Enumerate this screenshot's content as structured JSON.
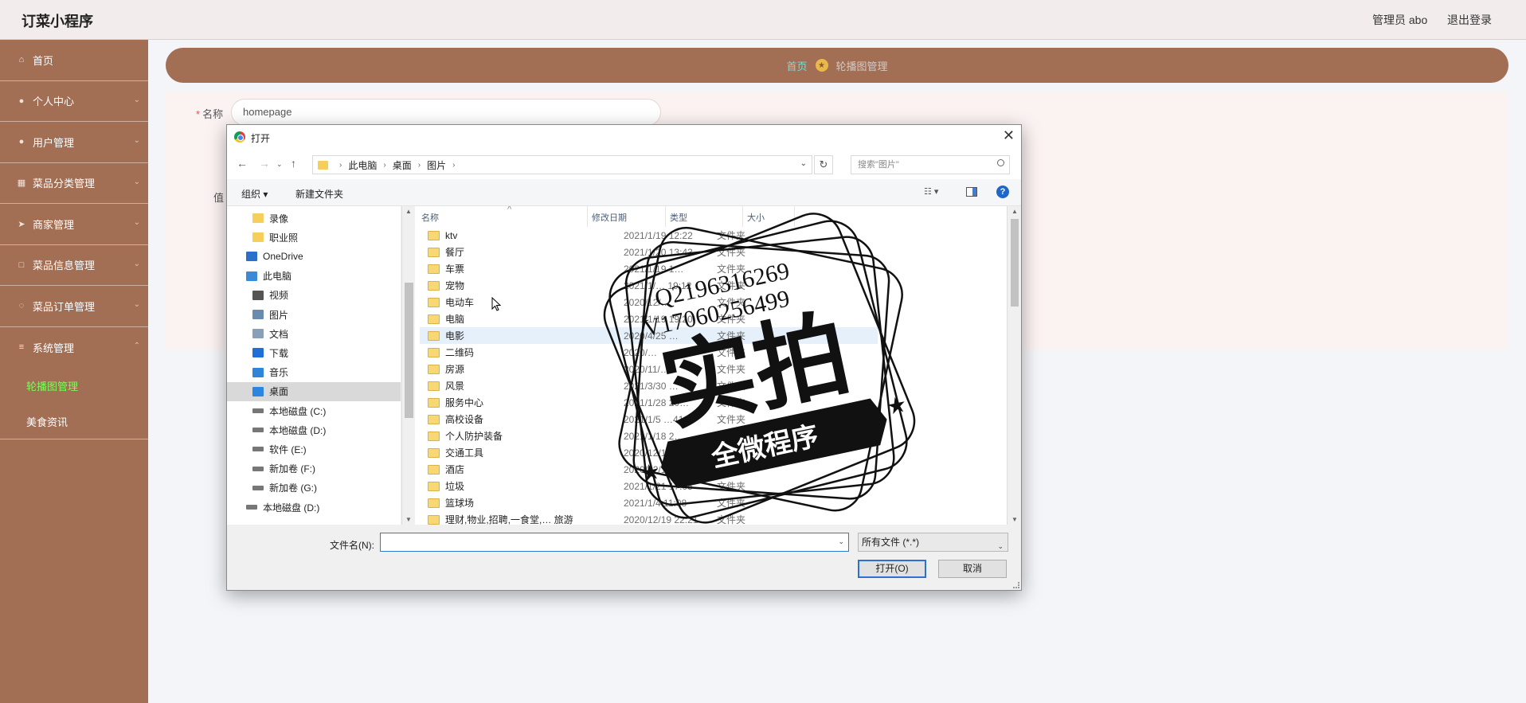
{
  "app": {
    "title": "订菜小程序"
  },
  "header": {
    "admin_label": "管理员 abo",
    "logout_label": "退出登录"
  },
  "sidebar": {
    "items": [
      {
        "label": "首页",
        "icon": "home-icon"
      },
      {
        "label": "个人中心",
        "icon": "user-icon"
      },
      {
        "label": "用户管理",
        "icon": "microphone-icon"
      },
      {
        "label": "菜品分类管理",
        "icon": "grid-icon"
      },
      {
        "label": "商家管理",
        "icon": "send-icon"
      },
      {
        "label": "菜品信息管理",
        "icon": "box-icon"
      },
      {
        "label": "菜品订单管理",
        "icon": "loading-icon"
      },
      {
        "label": "系统管理",
        "icon": "layers-icon"
      }
    ],
    "subitems": [
      {
        "label": "轮播图管理",
        "active": true
      },
      {
        "label": "美食资讯",
        "active": false
      }
    ]
  },
  "breadcrumb": {
    "home": "首页",
    "current": "轮播图管理"
  },
  "form": {
    "name_label": "名称",
    "name_value": "homepage",
    "value_label": "值"
  },
  "dialog": {
    "title": "打开",
    "path": [
      "此电脑",
      "桌面",
      "图片"
    ],
    "search_placeholder": "搜索\"图片\"",
    "toolbar": {
      "organize": "组织 ▾",
      "new_folder": "新建文件夹"
    },
    "nav": [
      {
        "label": "录像",
        "icon": "folder-icon",
        "indent": 1
      },
      {
        "label": "职业照",
        "icon": "folder-icon",
        "indent": 1
      },
      {
        "label": "OneDrive",
        "icon": "onedrive-icon",
        "indent": 0
      },
      {
        "label": "此电脑",
        "icon": "pc-icon",
        "indent": 0
      },
      {
        "label": "视频",
        "icon": "video-icon",
        "indent": 1
      },
      {
        "label": "图片",
        "icon": "pictures-icon",
        "indent": 1
      },
      {
        "label": "文档",
        "icon": "document-icon",
        "indent": 1
      },
      {
        "label": "下载",
        "icon": "download-icon",
        "indent": 1
      },
      {
        "label": "音乐",
        "icon": "music-icon",
        "indent": 1
      },
      {
        "label": "桌面",
        "icon": "desktop-icon",
        "indent": 1,
        "selected": true
      },
      {
        "label": "本地磁盘 (C:)",
        "icon": "drive-icon",
        "indent": 1
      },
      {
        "label": "本地磁盘 (D:)",
        "icon": "drive-icon",
        "indent": 1
      },
      {
        "label": "软件 (E:)",
        "icon": "drive-icon",
        "indent": 1
      },
      {
        "label": "新加卷 (F:)",
        "icon": "drive-icon",
        "indent": 1
      },
      {
        "label": "新加卷 (G:)",
        "icon": "drive-icon",
        "indent": 1
      },
      {
        "label": "本地磁盘 (D:)",
        "icon": "drive-icon",
        "indent": 0
      }
    ],
    "columns": [
      "名称",
      "修改日期",
      "类型",
      "大小"
    ],
    "files": [
      {
        "name": "ktv",
        "date": "2021/1/19 12:22",
        "type": "文件夹"
      },
      {
        "name": "餐厅",
        "date": "2021/1/20 13:43",
        "type": "文件夹"
      },
      {
        "name": "车票",
        "date": "2021/1/19 1…",
        "type": "文件夹"
      },
      {
        "name": "宠物",
        "date": "2021/1/… 19:12",
        "type": "文件夹"
      },
      {
        "name": "电动车",
        "date": "2020/12/…",
        "type": "文件夹"
      },
      {
        "name": "电脑",
        "date": "2021/1/19 19:20",
        "type": "文件夹"
      },
      {
        "name": "电影",
        "date": "2020/4/25 …",
        "type": "文件夹",
        "highlight": true
      },
      {
        "name": "二维码",
        "date": "2020/…",
        "type": "文件夹"
      },
      {
        "name": "房源",
        "date": "2020/11/…",
        "type": "文件夹"
      },
      {
        "name": "风景",
        "date": "2021/3/30 …",
        "type": "文件夹"
      },
      {
        "name": "服务中心",
        "date": "2021/1/28 20…",
        "type": "文件夹"
      },
      {
        "name": "高校设备",
        "date": "2021/1/5 …41",
        "type": "文件夹"
      },
      {
        "name": "个人防护装备",
        "date": "2021/1/18 2…",
        "type": "文件夹"
      },
      {
        "name": "交通工具",
        "date": "2020/12/1… 14:4…",
        "type": "文件夹"
      },
      {
        "name": "酒店",
        "date": "2020/12/15 14:…",
        "type": "文件夹"
      },
      {
        "name": "垃圾",
        "date": "2021/1/21 17:05",
        "type": "文件夹"
      },
      {
        "name": "篮球场",
        "date": "2021/1/4 11:08",
        "type": "文件夹"
      },
      {
        "name": "理财,物业,招聘,一食堂,… 旅游",
        "date": "2020/12/19 22:21",
        "type": "文件夹"
      }
    ],
    "filename_label": "文件名(N):",
    "filename_value": "",
    "filetype_value": "所有文件 (*.*)",
    "open_button": "打开(O)",
    "cancel_button": "取消"
  },
  "watermark": {
    "line1": "Q2196316269",
    "line2": "V17060256499",
    "main": "实拍",
    "banner": "全微程序"
  },
  "colors": {
    "sidebar": "#a26e54",
    "active_submenu": "#7dfb5c",
    "breadcrumb_home": "#7ddcd6",
    "page_bg": "#f4f5f9"
  }
}
